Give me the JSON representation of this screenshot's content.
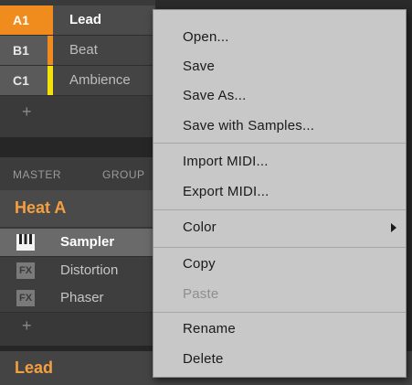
{
  "groups": [
    {
      "slot": "A1",
      "name": "Lead",
      "color": "#f08c1e",
      "selected": true
    },
    {
      "slot": "B1",
      "name": "Beat",
      "color": "#f08c1e",
      "selected": false
    },
    {
      "slot": "C1",
      "name": "Ambience",
      "color": "#f2e20a",
      "selected": false
    }
  ],
  "add_group_label": "+",
  "tabs": {
    "master": "MASTER",
    "group": "GROUP"
  },
  "sound_title": "Heat A",
  "plugins": [
    {
      "icon": "piano-icon",
      "icon_text": "",
      "name": "Sampler",
      "selected": true
    },
    {
      "icon": "fx-icon",
      "icon_text": "FX",
      "name": "Distortion",
      "selected": false
    },
    {
      "icon": "fx-icon",
      "icon_text": "FX",
      "name": "Phaser",
      "selected": false
    }
  ],
  "add_plugin_label": "+",
  "bottom_title": "Lead",
  "menu": {
    "open": "Open...",
    "save": "Save",
    "save_as": "Save As...",
    "save_with_samples": "Save with Samples...",
    "import_midi": "Import MIDI...",
    "export_midi": "Export MIDI...",
    "color": "Color",
    "copy": "Copy",
    "paste": "Paste",
    "rename": "Rename",
    "delete": "Delete"
  }
}
